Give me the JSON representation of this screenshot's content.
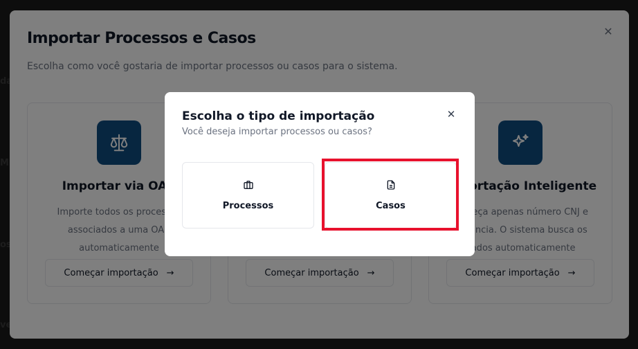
{
  "background": {
    "edge_fragments": [
      "da",
      "M",
      "os",
      "ve"
    ]
  },
  "outer_modal": {
    "title": "Importar Processos e Casos",
    "subtitle": "Escolha como você gostaria de importar processos ou casos para o sistema.",
    "close_icon": "close-icon",
    "cards": [
      {
        "icon": "scale-icon",
        "title": "Importar via OAB",
        "description": "Importe todos os processos associados a uma OAB automaticamente",
        "button_label": "Começar importação"
      },
      {
        "icon": "file-icon",
        "title": "",
        "description": "",
        "button_label": "Começar importação"
      },
      {
        "icon": "sparkles-icon",
        "title": "Importação Inteligente",
        "description": "Forneça apenas número CNJ e instância. O sistema busca os dados automaticamente",
        "button_label": "Começar importação"
      }
    ]
  },
  "dialog": {
    "title": "Escolha o tipo de importação",
    "subtitle": "Você deseja importar processos ou casos?",
    "options": [
      {
        "label": "Processos",
        "icon": "briefcase-icon"
      },
      {
        "label": "Casos",
        "icon": "document-icon",
        "highlighted": true
      }
    ]
  },
  "colors": {
    "brand": "#0f4c81",
    "highlight": "#e8112d",
    "overlay": "rgba(0,0,0,0.5)"
  }
}
